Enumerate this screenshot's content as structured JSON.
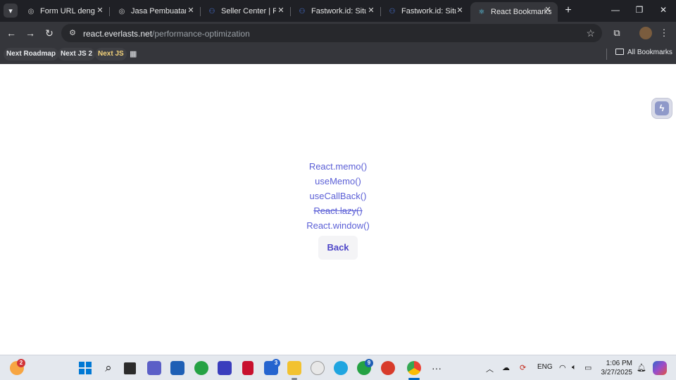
{
  "browser": {
    "tabs": [
      {
        "title": "Form URL dengan",
        "icon": "globe-icon",
        "active": false
      },
      {
        "title": "Jasa Pembuatan W",
        "icon": "globe-icon",
        "active": false
      },
      {
        "title": "Seller Center | Fast",
        "icon": "fastwork-icon",
        "active": false
      },
      {
        "title": "Fastwork.id: Situs F",
        "icon": "fastwork-icon",
        "active": false
      },
      {
        "title": "Fastwork.id: Situs F",
        "icon": "fastwork-icon",
        "active": false
      },
      {
        "title": "React Bookmarks",
        "icon": "react-icon",
        "active": true
      }
    ],
    "url": {
      "domain": "react.everlasts.net",
      "path": "/performance-optimization"
    },
    "bookmarks": [
      {
        "label": "Next Roadmap",
        "color": "#e8eaed"
      },
      {
        "label": "Next JS 2",
        "color": "#e8eaed"
      },
      {
        "label": "Next JS",
        "color": "#f4d37a"
      }
    ],
    "all_bookmarks_label": "All Bookmarks"
  },
  "page": {
    "links": [
      {
        "label": "React.memo()",
        "strikethrough": false
      },
      {
        "label": "useMemo()",
        "strikethrough": false
      },
      {
        "label": "useCallBack()",
        "strikethrough": false
      },
      {
        "label": "React.lazy()",
        "strikethrough": true
      },
      {
        "label": "React.window()",
        "strikethrough": false
      }
    ],
    "back_label": "Back",
    "link_color": "#5b5fd6"
  },
  "taskbar": {
    "weather_badge": "2",
    "todo_badge": "3",
    "whatsapp_badge": "9",
    "language": "ENG",
    "time": "1:06 PM",
    "date": "3/27/2025"
  }
}
